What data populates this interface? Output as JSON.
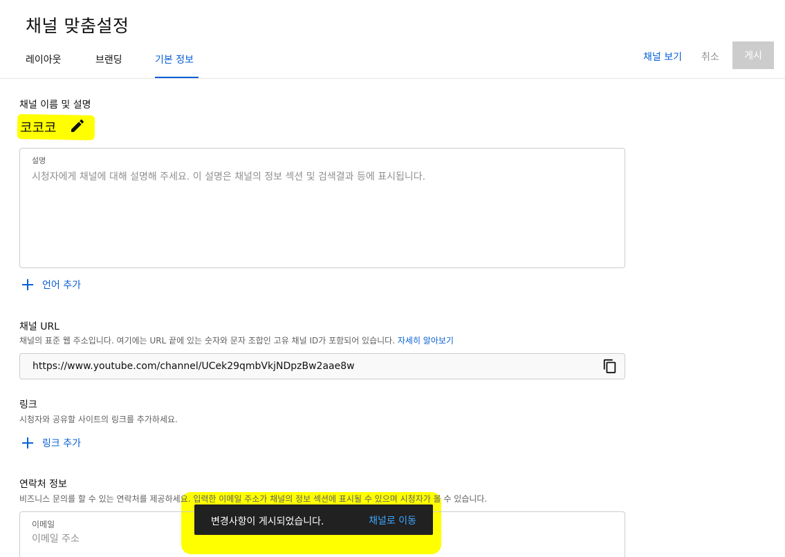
{
  "page": {
    "title": "채널 맞춤설정"
  },
  "tabs": [
    {
      "label": "레이아웃",
      "active": false
    },
    {
      "label": "브랜딩",
      "active": false
    },
    {
      "label": "기본 정보",
      "active": true
    }
  ],
  "header_actions": {
    "view_channel": "채널 보기",
    "cancel": "취소",
    "publish": "게시"
  },
  "name_section": {
    "title": "채널 이름 및 설명",
    "channel_name": "코코코",
    "edit_icon": "pencil-icon"
  },
  "description": {
    "label": "설명",
    "placeholder": "시청자에게 채널에 대해 설명해 주세요. 이 설명은 채널의 정보 섹션 및 검색결과 등에 표시됩니다.",
    "add_language": "언어 추가"
  },
  "url_section": {
    "title": "채널 URL",
    "desc": "채널의 표준 웹 주소입니다. 여기에는 URL 끝에 있는 숫자와 문자 조합인 고유 채널 ID가 포함되어 있습니다.",
    "learn_more": "자세히 알아보기",
    "url": "https://www.youtube.com/channel/UCek29qmbVkjNDpzBw2aae8w",
    "copy_icon": "copy-icon"
  },
  "links_section": {
    "title": "링크",
    "desc": "시청자와 공유할 사이트의 링크를 추가하세요.",
    "add_link": "링크 추가"
  },
  "contact_section": {
    "title": "연락처 정보",
    "desc": "비즈니스 문의를 할 수 있는 연락처를 제공하세요. 입력한 이메일 주소가 채널의 정보 섹션에 표시될 수 있으며 시청자가 볼 수 있습니다.",
    "email_label": "이메일",
    "email_placeholder": "이메일 주소"
  },
  "toast": {
    "message": "변경사항이 게시되었습니다.",
    "action": "채널로 이동"
  },
  "colors": {
    "accent": "#065fd4",
    "highlight": "#ffff00",
    "toast_bg": "#212121",
    "toast_action": "#3ea6ff"
  }
}
